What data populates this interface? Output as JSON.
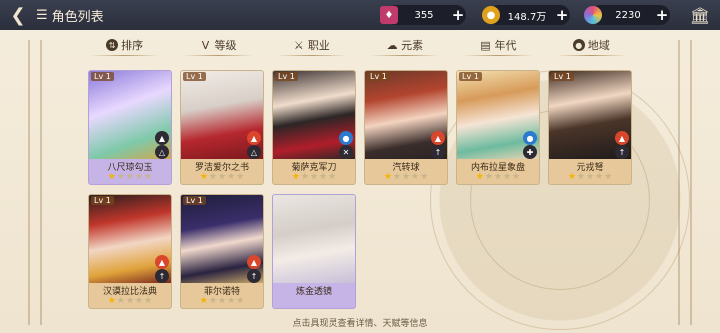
{
  "header": {
    "back_icon": "back-arrow-icon",
    "title": "角色列表"
  },
  "currencies": [
    {
      "name": "gem",
      "icon": "gem-icon",
      "color": "#c03a6b",
      "value": "355"
    },
    {
      "name": "gold",
      "icon": "coin-icon",
      "color": "#e0a21c",
      "value": "148.7万"
    },
    {
      "name": "crystal",
      "icon": "crystal-icon",
      "color": "#8b6fd8",
      "value": "2230"
    }
  ],
  "filters": [
    {
      "label": "排序",
      "icon": "sort-icon"
    },
    {
      "label": "等级",
      "icon": "level-icon"
    },
    {
      "label": "职业",
      "icon": "class-icon"
    },
    {
      "label": "元素",
      "icon": "element-icon"
    },
    {
      "label": "年代",
      "icon": "era-icon"
    },
    {
      "label": "地域",
      "icon": "region-icon"
    }
  ],
  "characters": [
    {
      "name": "八尺琼勾玉",
      "level": "Lv 1",
      "stars": 1,
      "rarity": "purple"
    },
    {
      "name": "罗洁爱尔之书",
      "level": "Lv 1",
      "stars": 1,
      "rarity": "gold"
    },
    {
      "name": "菊萨克军刀",
      "level": "Lv 1",
      "stars": 1,
      "rarity": "gold"
    },
    {
      "name": "汽转球",
      "level": "Lv 1",
      "stars": 1,
      "rarity": "gold"
    },
    {
      "name": "内布拉星象盘",
      "level": "Lv 1",
      "stars": 1,
      "rarity": "gold"
    },
    {
      "name": "元戎弩",
      "level": "Lv 1",
      "stars": 1,
      "rarity": "gold"
    },
    {
      "name": "汉谟拉比法典",
      "level": "Lv 1",
      "stars": 1,
      "rarity": "gold"
    },
    {
      "name": "菲尔诺特",
      "level": "Lv 1",
      "stars": 1,
      "rarity": "gold"
    },
    {
      "name": "炼金透镜",
      "level": "",
      "stars": 0,
      "rarity": "purple"
    }
  ],
  "hint": "点击具现灵查看详情、天赋等信息"
}
